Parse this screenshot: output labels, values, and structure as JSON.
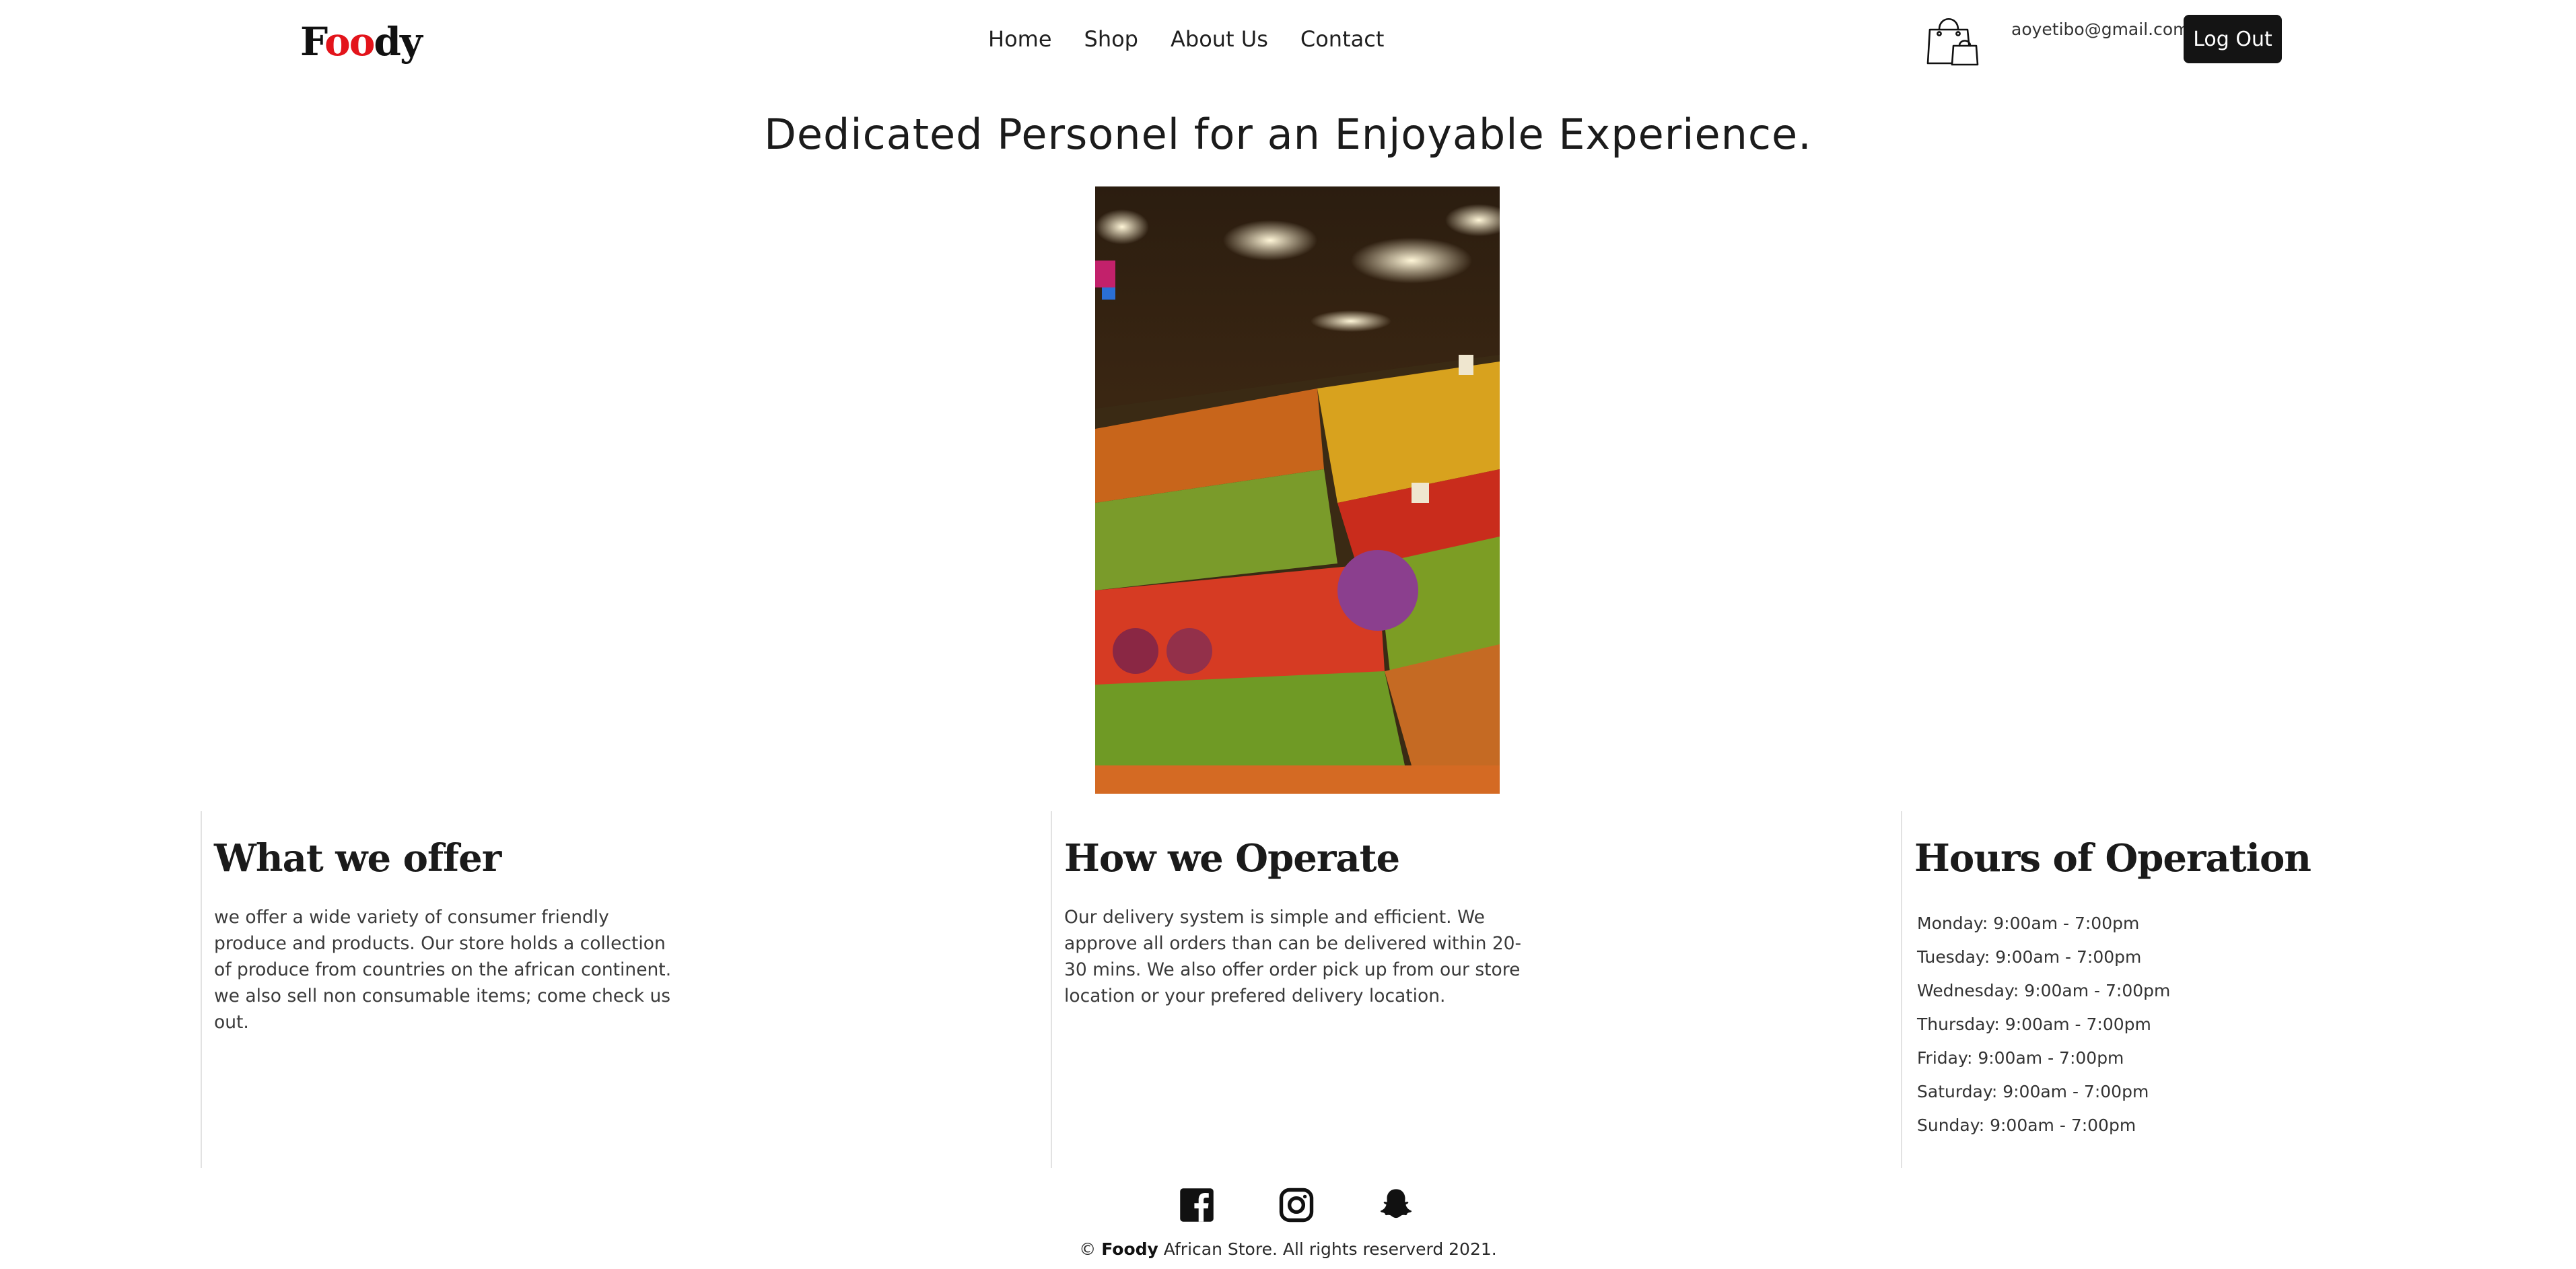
{
  "header": {
    "logo_start": "F",
    "logo_middle": "oo",
    "logo_end": "dy",
    "nav": [
      "Home",
      "Shop",
      "About Us",
      "Contact"
    ],
    "cart_icon": "shopping-bag-icon",
    "user_email": "aoyetibo@gmail.com",
    "logout_label": "Log Out"
  },
  "hero": {
    "title": "Dedicated Personel for an Enjoyable Experience."
  },
  "sections": {
    "offer": {
      "heading": "What we offer",
      "text": "we offer a wide variety of consumer friendly produce and products. Our store holds a collection of produce from countries on the african continent. we also sell non consumable items; come check us out."
    },
    "operate": {
      "heading": "How we Operate",
      "text": "Our delivery system is simple and efficient. We approve all orders than can be delivered within 20-30 mins. We also offer order pick up from our store location or your prefered delivery location."
    },
    "hours": {
      "heading": "Hours of Operation",
      "items": [
        "Monday: 9:00am - 7:00pm",
        "Tuesday: 9:00am - 7:00pm",
        "Wednesday: 9:00am - 7:00pm",
        "Thursday: 9:00am - 7:00pm",
        "Friday: 9:00am - 7:00pm",
        "Saturday: 9:00am - 7:00pm",
        "Sunday: 9:00am - 7:00pm"
      ]
    }
  },
  "footer": {
    "social_icons": [
      "facebook-icon",
      "instagram-icon",
      "snapchat-icon"
    ],
    "copyright_prefix": "© ",
    "copyright_brand": "Foody",
    "copyright_suffix": " African Store. All rights reserverd 2021."
  },
  "colors": {
    "logo_accent": "#e3141b",
    "button_bg": "#141414",
    "text": "#1a1a1a",
    "divider": "#e2e2e2"
  }
}
